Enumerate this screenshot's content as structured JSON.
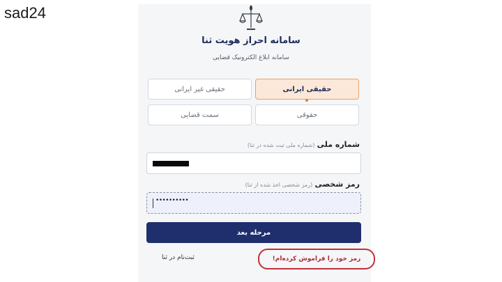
{
  "corner_label": "sad24",
  "header": {
    "title": "سامانه احراز هویت ثنا",
    "subtitle": "سامانه ابلاغ الکترونیک قضایی"
  },
  "tabs": {
    "row1": [
      {
        "label": "حقیقی ایرانی",
        "active": true
      },
      {
        "label": "حقیقی غیر ایرانی",
        "active": false
      }
    ],
    "row2": [
      {
        "label": "حقوقی",
        "active": false
      },
      {
        "label": "سمت قضایی",
        "active": false
      }
    ]
  },
  "national_id": {
    "label": "شماره ملی",
    "hint": "(شماره ملی ثبت شده در ثنا)",
    "value": "redacted"
  },
  "password": {
    "label": "رمز شخصی",
    "hint": "(رمز شخصی اخذ شده از ثنا)",
    "value": "••••••••••"
  },
  "next_button": "مرحله بعد",
  "forgot_link": "رمز خود را فراموش کرده‌ام!",
  "register_link": "ثبت‌نام در ثنا",
  "colors": {
    "primary": "#1f2f6e",
    "active_tab_bg": "#fbe8d8",
    "active_tab_border": "#e8a16b",
    "forgot_highlight": "#c0303a"
  }
}
